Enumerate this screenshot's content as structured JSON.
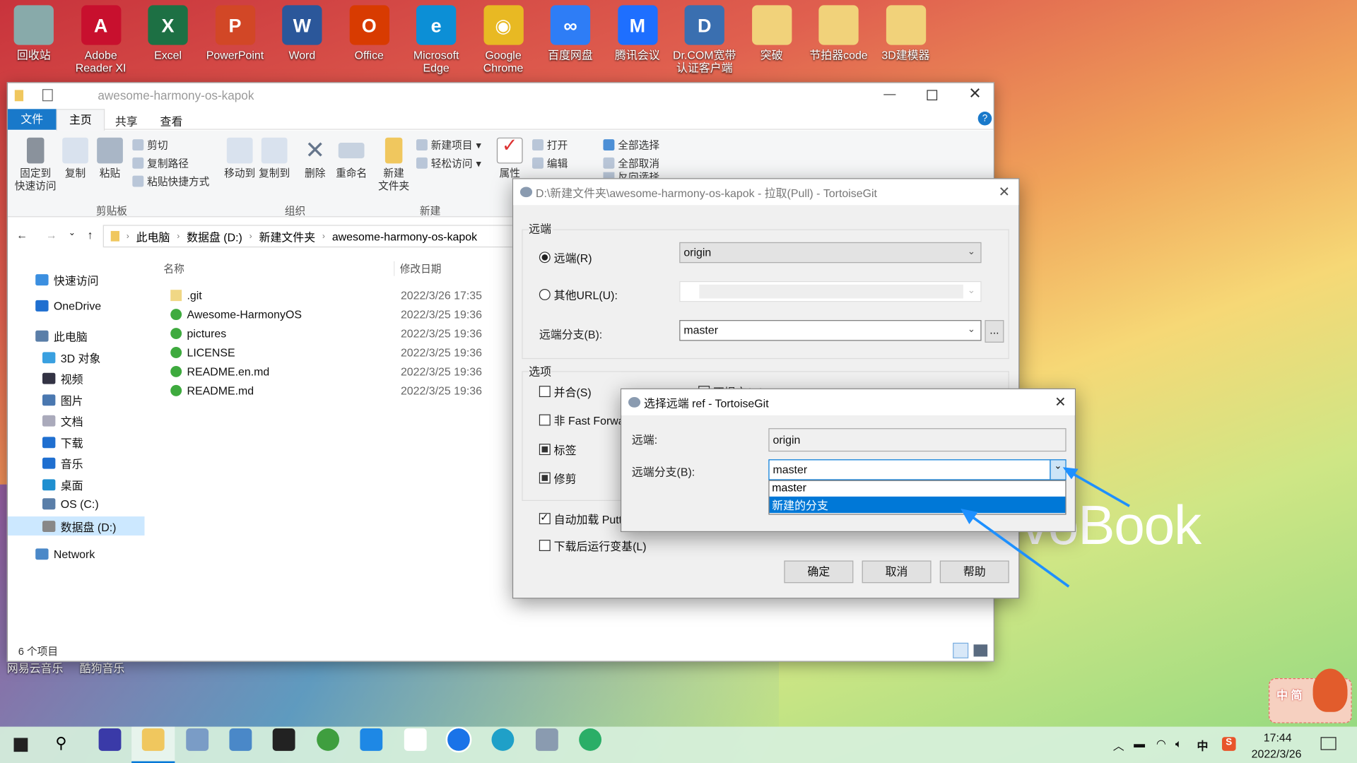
{
  "desktop": {
    "icons": [
      {
        "label": "回收站",
        "color": "#8aa"
      },
      {
        "label": "Adobe Reader XI",
        "color": "#c8102e",
        "glyph": "A"
      },
      {
        "label": "Excel",
        "color": "#1d7044",
        "glyph": "X"
      },
      {
        "label": "PowerPoint",
        "color": "#d24726",
        "glyph": "P"
      },
      {
        "label": "Word",
        "color": "#2b579a",
        "glyph": "W"
      },
      {
        "label": "Office",
        "color": "#d83b01",
        "glyph": "O"
      },
      {
        "label": "Microsoft Edge",
        "color": "#0c8fd6",
        "glyph": "e"
      },
      {
        "label": "Google Chrome",
        "color": "#e8b923",
        "glyph": "◉"
      },
      {
        "label": "百度网盘",
        "color": "#2e7df6",
        "glyph": "∞"
      },
      {
        "label": "腾讯会议",
        "color": "#1e6fff",
        "glyph": "M"
      },
      {
        "label": "Dr.COM宽带认证客户端",
        "color": "#3a6fb0",
        "glyph": "D"
      },
      {
        "label": "突破",
        "color": "#f1d27a"
      },
      {
        "label": "节拍器code",
        "color": "#f1d27a"
      },
      {
        "label": "3D建模器",
        "color": "#f1d27a"
      }
    ],
    "bottom_labels": [
      "网易云音乐",
      "酷狗音乐"
    ],
    "brand_text": "voBook"
  },
  "explorer": {
    "title": "awesome-harmony-os-kapok",
    "tabs": [
      "文件",
      "主页",
      "共享",
      "查看"
    ],
    "ribbon": {
      "clipboard": {
        "group": "剪贴板",
        "pin": "固定到\n快速访问",
        "copy": "复制",
        "paste": "粘贴",
        "cut": "剪切",
        "copy_path": "复制路径",
        "paste_shortcut": "粘贴快捷方式"
      },
      "organize": {
        "group": "组织",
        "move_to": "移动到",
        "copy_to": "复制到",
        "delete": "删除",
        "rename": "重命名"
      },
      "new": {
        "group": "新建",
        "new_folder": "新建\n文件夹",
        "new_item": "新建项目",
        "easy_access": "轻松访问"
      },
      "open": {
        "properties": "属性",
        "open": "打开",
        "edit": "编辑"
      },
      "select": {
        "select_all": "全部选择",
        "select_none": "全部取消",
        "invert": "反向选择"
      }
    },
    "breadcrumb": [
      "此电脑",
      "数据盘 (D:)",
      "新建文件夹",
      "awesome-harmony-os-kapok"
    ],
    "nav": [
      "快速访问",
      "OneDrive",
      "此电脑",
      "3D 对象",
      "视频",
      "图片",
      "文档",
      "下载",
      "音乐",
      "桌面",
      "OS (C:)",
      "数据盘 (D:)",
      "Network"
    ],
    "columns": {
      "name": "名称",
      "date": "修改日期"
    },
    "files": [
      {
        "name": ".git",
        "date": "2022/3/26 17:35"
      },
      {
        "name": "Awesome-HarmonyOS",
        "date": "2022/3/25 19:36"
      },
      {
        "name": "pictures",
        "date": "2022/3/25 19:36"
      },
      {
        "name": "LICENSE",
        "date": "2022/3/25 19:36"
      },
      {
        "name": "README.en.md",
        "date": "2022/3/25 19:36"
      },
      {
        "name": "README.md",
        "date": "2022/3/25 19:36"
      }
    ],
    "status": "6 个项目"
  },
  "pull_dialog": {
    "title": "D:\\新建文件夹\\awesome-harmony-os-kapok - 拉取(Pull) - TortoiseGit",
    "remote_group": "远端",
    "remote_radio": "远端(R)",
    "remote_value": "origin",
    "url_radio": "其他URL(U):",
    "url_value": "",
    "branch_label": "远端分支(B):",
    "branch_value": "master",
    "browse": "...",
    "options_group": "选项",
    "opt_squash": "并合(S)",
    "opt_nocommit": "不提交(M)",
    "opt_noff": "非 Fast Forward",
    "opt_tags": "标签",
    "opt_prune": "修剪",
    "opt_putty": "自动加载 Putty",
    "opt_submodule": "下载后运行变基(L)",
    "ok": "确定",
    "cancel": "取消",
    "help": "帮助"
  },
  "ref_dialog": {
    "title": "选择远端 ref - TortoiseGit",
    "remote_label": "远端:",
    "remote_value": "origin",
    "branch_label": "远端分支(B):",
    "branch_value": "master",
    "options": [
      "master",
      "新建的分支"
    ],
    "selected_option": "新建的分支"
  },
  "taskbar": {
    "time": "17:44",
    "date": "2022/3/26",
    "ime": "中",
    "ime_widget": "中 简"
  },
  "colors": {
    "accent": "#0067c0",
    "selection": "#0078d7",
    "arrow": "#1e90ff"
  }
}
